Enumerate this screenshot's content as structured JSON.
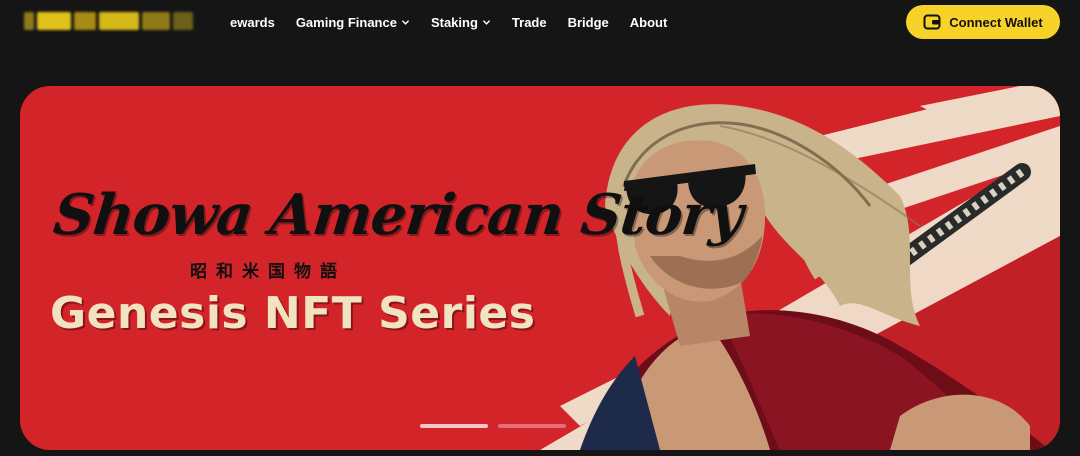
{
  "nav": {
    "items": [
      {
        "label": "ewards",
        "has_dropdown": false
      },
      {
        "label": "Gaming Finance",
        "has_dropdown": true
      },
      {
        "label": "Staking",
        "has_dropdown": true
      },
      {
        "label": "Trade",
        "has_dropdown": false
      },
      {
        "label": "Bridge",
        "has_dropdown": false
      },
      {
        "label": "About",
        "has_dropdown": false
      }
    ],
    "dropdown_icon": "chevron-down-icon",
    "blurred_logo_colors": [
      "#a88a14",
      "#e0c21a",
      "#d7b819",
      "#8e7a19"
    ]
  },
  "connect_wallet": {
    "label": "Connect Wallet",
    "icon": "wallet-icon",
    "color": "#f7d229"
  },
  "hero": {
    "title_script": "Showa American Story",
    "title_jp": "昭和米国物語",
    "subtitle": "Genesis NFT Series",
    "background_color": "#d3242a",
    "slide_active": 1,
    "slide_count": 2
  }
}
